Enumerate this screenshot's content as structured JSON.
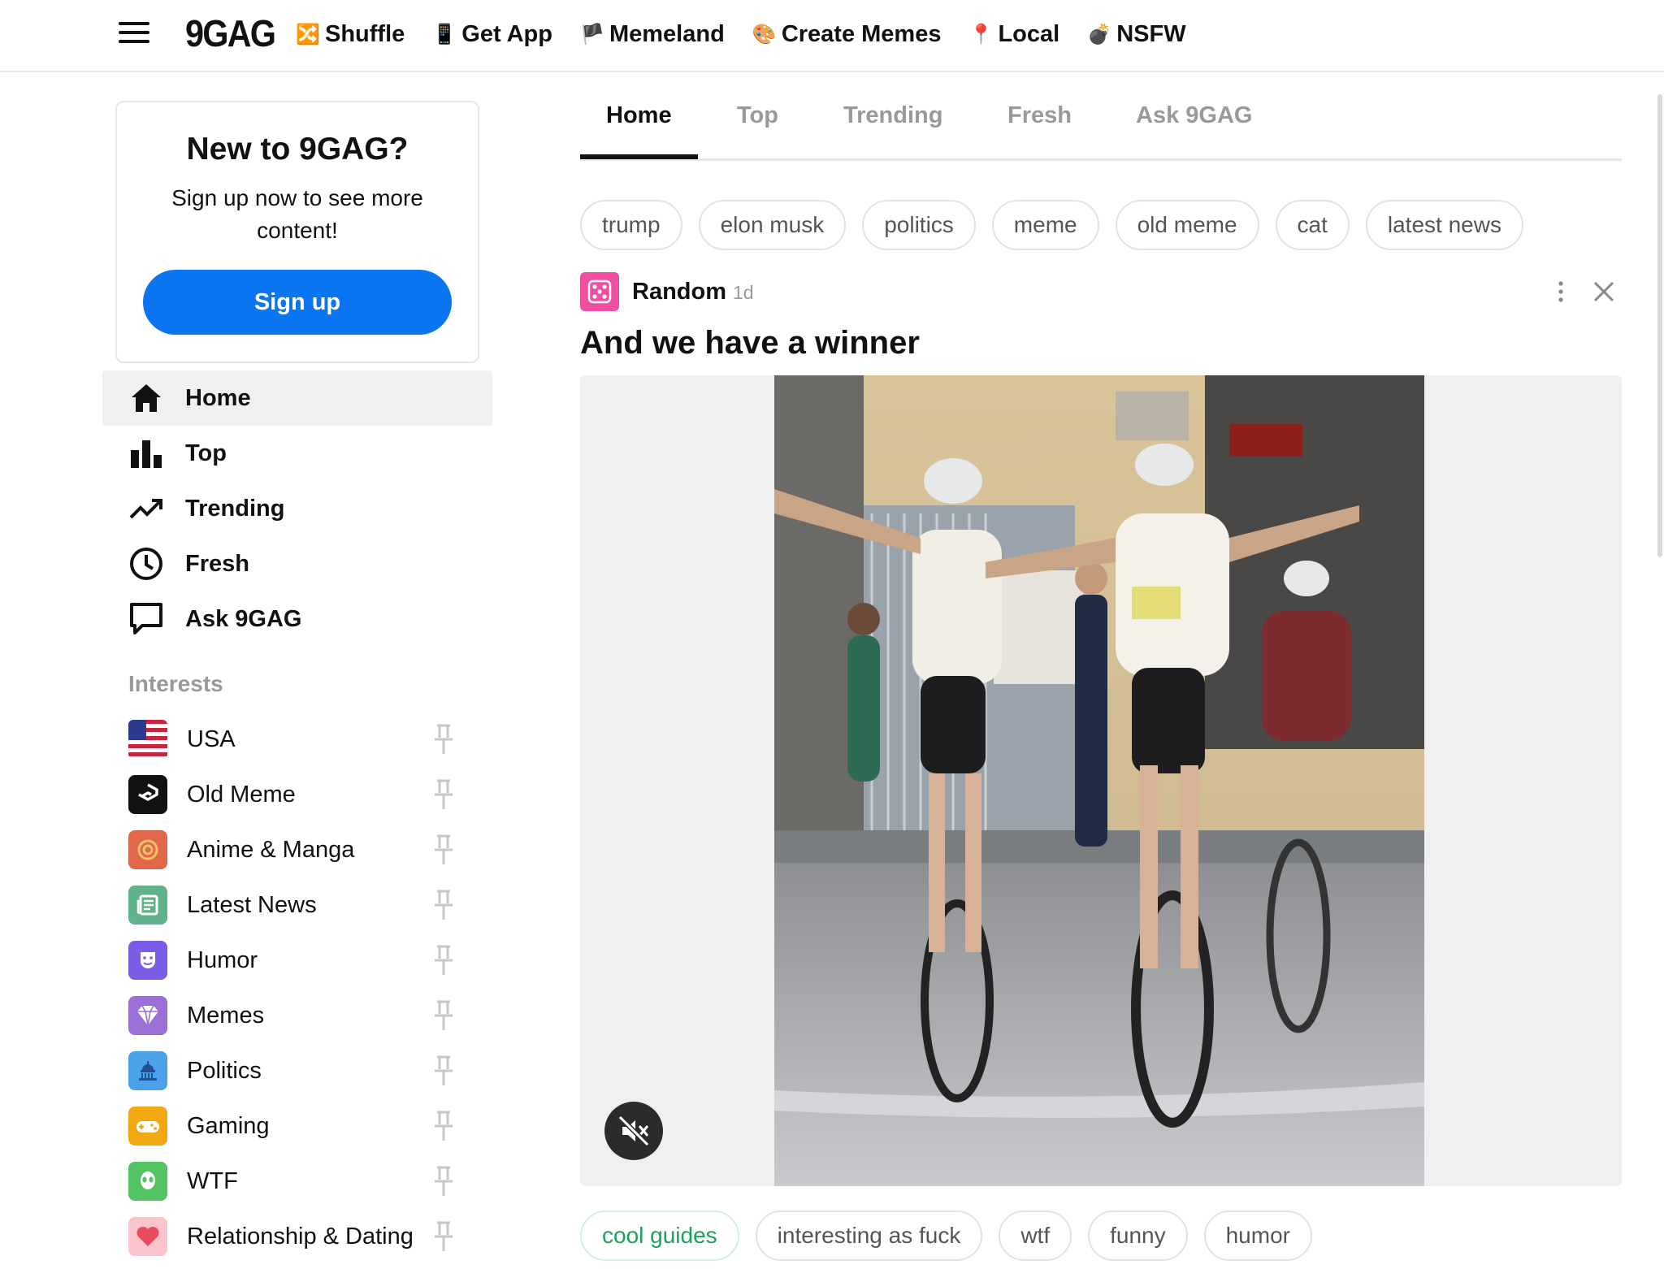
{
  "header": {
    "brand": "9GAG",
    "nav": [
      {
        "name": "shuffle",
        "icon": "shuffle-icon",
        "glyph": "🔀",
        "label": "Shuffle"
      },
      {
        "name": "get-app",
        "icon": "phone-icon",
        "glyph": "📱",
        "label": "Get App"
      },
      {
        "name": "memeland",
        "icon": "pirate-flag-icon",
        "glyph": "🏴",
        "label": "Memeland"
      },
      {
        "name": "create-memes",
        "icon": "palette-icon",
        "glyph": "🎨",
        "label": "Create Memes"
      },
      {
        "name": "local",
        "icon": "pin-icon",
        "glyph": "📍",
        "label": "Local"
      },
      {
        "name": "nsfw",
        "icon": "bomb-icon",
        "glyph": "💣",
        "label": "NSFW"
      }
    ]
  },
  "signup": {
    "title": "New to 9GAG?",
    "subtitle": "Sign up now to see more content!",
    "button": "Sign up"
  },
  "sidebar": {
    "items": [
      {
        "label": "Home",
        "icon": "home-icon"
      },
      {
        "label": "Top",
        "icon": "bar-chart-icon"
      },
      {
        "label": "Trending",
        "icon": "trending-icon"
      },
      {
        "label": "Fresh",
        "icon": "clock-icon"
      },
      {
        "label": "Ask 9GAG",
        "icon": "speech-bubble-icon"
      }
    ],
    "interests_label": "Interests",
    "interests": [
      {
        "label": "USA",
        "icon": "us-flag-icon",
        "color": "#c9243f"
      },
      {
        "label": "Old Meme",
        "icon": "old-meme-icon",
        "color": "#111111"
      },
      {
        "label": "Anime & Manga",
        "icon": "spiral-icon",
        "color": "#e0674a"
      },
      {
        "label": "Latest News",
        "icon": "newspaper-icon",
        "color": "#5fb28a"
      },
      {
        "label": "Humor",
        "icon": "mask-icon",
        "color": "#7b5ce6"
      },
      {
        "label": "Memes",
        "icon": "diamond-icon",
        "color": "#9a70d6"
      },
      {
        "label": "Politics",
        "icon": "capitol-icon",
        "color": "#4aa3ea"
      },
      {
        "label": "Gaming",
        "icon": "gamepad-icon",
        "color": "#f3a712"
      },
      {
        "label": "WTF",
        "icon": "alien-icon",
        "color": "#52c463"
      },
      {
        "label": "Relationship & Dating",
        "icon": "heart-icon",
        "color": "#f37b8a"
      }
    ]
  },
  "tabs": {
    "items": [
      "Home",
      "Top",
      "Trending",
      "Fresh",
      "Ask 9GAG"
    ],
    "active": "Home"
  },
  "chips": [
    "trump",
    "elon musk",
    "politics",
    "meme",
    "old meme",
    "cat",
    "latest news"
  ],
  "post": {
    "section": "Random",
    "age": "1d",
    "title": "And we have a winner",
    "tags": [
      "cool guides",
      "interesting as fuck",
      "wtf",
      "funny",
      "humor"
    ]
  },
  "colors": {
    "accent": "#0b74f0",
    "section_icon": "#f04fa1",
    "highlight_tag": "#1ba35a"
  }
}
